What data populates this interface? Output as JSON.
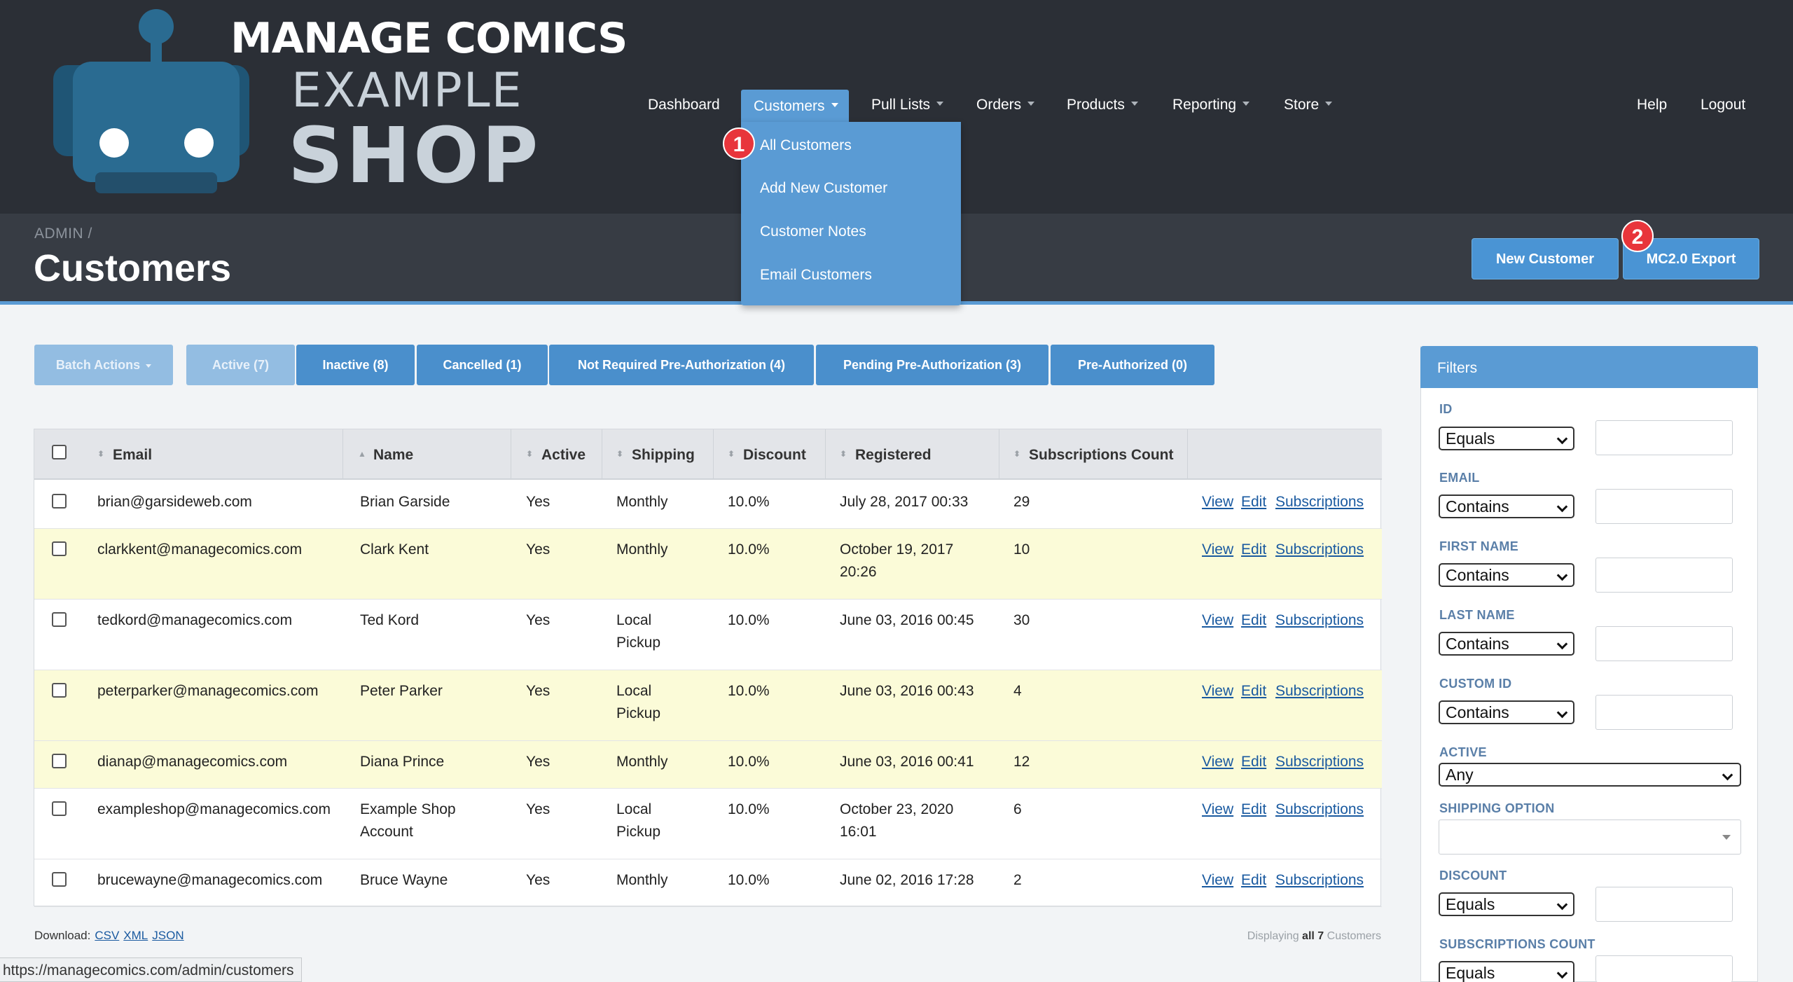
{
  "brand": {
    "line1": "MANAGE COMICS",
    "line2": "EXAMPLE",
    "line3": "SHOP"
  },
  "nav": {
    "dashboard": "Dashboard",
    "customers": "Customers",
    "pull_lists": "Pull Lists",
    "orders": "Orders",
    "products": "Products",
    "reporting": "Reporting",
    "store": "Store",
    "help": "Help",
    "logout": "Logout"
  },
  "dropdown": {
    "items": [
      "All Customers",
      "Add New Customer",
      "Customer Notes",
      "Email Customers"
    ]
  },
  "callouts": [
    "1",
    "2"
  ],
  "breadcrumb": "ADMIN /",
  "page_title": "Customers",
  "buttons": {
    "new_customer": "New Customer",
    "export": "MC2.0 Export"
  },
  "tabs": [
    "Batch Actions",
    "Active (7)",
    "Inactive (8)",
    "Cancelled (1)",
    "Not Required Pre-Authorization (4)",
    "Pending Pre-Authorization (3)",
    "Pre-Authorized (0)"
  ],
  "table": {
    "sort_up": "▲",
    "sort_both": "⬍",
    "columns": [
      "Email",
      "Name",
      "Active",
      "Shipping",
      "Discount",
      "Registered",
      "Subscriptions Count"
    ],
    "rows": [
      {
        "email": "brian@garsideweb.com",
        "name1": "Brian Garside",
        "name2": "",
        "active": "Yes",
        "ship1": "Monthly",
        "ship2": "",
        "discount": "10.0%",
        "reg1": "July 28, 2017 00:33",
        "reg2": "",
        "subs": "29"
      },
      {
        "email": "clarkkent@managecomics.com",
        "name1": "Clark Kent",
        "name2": "",
        "active": "Yes",
        "ship1": "Monthly",
        "ship2": "",
        "discount": "10.0%",
        "reg1": "October 19, 2017",
        "reg2": "20:26",
        "subs": "10"
      },
      {
        "email": "tedkord@managecomics.com",
        "name1": "Ted Kord",
        "name2": "",
        "active": "Yes",
        "ship1": "Local",
        "ship2": "Pickup",
        "discount": "10.0%",
        "reg1": "June 03, 2016 00:45",
        "reg2": "",
        "subs": "30"
      },
      {
        "email": "peterparker@managecomics.com",
        "name1": "Peter Parker",
        "name2": "",
        "active": "Yes",
        "ship1": "Local",
        "ship2": "Pickup",
        "discount": "10.0%",
        "reg1": "June 03, 2016 00:43",
        "reg2": "",
        "subs": "4"
      },
      {
        "email": "dianap@managecomics.com",
        "name1": "Diana Prince",
        "name2": "",
        "active": "Yes",
        "ship1": "Monthly",
        "ship2": "",
        "discount": "10.0%",
        "reg1": "June 03, 2016 00:41",
        "reg2": "",
        "subs": "12"
      },
      {
        "email": "exampleshop@managecomics.com",
        "name1": "Example Shop",
        "name2": "Account",
        "active": "Yes",
        "ship1": "Local",
        "ship2": "Pickup",
        "discount": "10.0%",
        "reg1": "October 23, 2020",
        "reg2": "16:01",
        "subs": "6"
      },
      {
        "email": "brucewayne@managecomics.com",
        "name1": "Bruce Wayne",
        "name2": "",
        "active": "Yes",
        "ship1": "Monthly",
        "ship2": "",
        "discount": "10.0%",
        "reg1": "June 02, 2016 17:28",
        "reg2": "",
        "subs": "2"
      }
    ],
    "actions": {
      "view": "View",
      "edit": "Edit",
      "subscriptions": "Subscriptions"
    }
  },
  "footer": {
    "download_label": "Download:",
    "formats": [
      "CSV",
      "XML",
      "JSON"
    ],
    "displaying_prefix": "Displaying",
    "displaying_count": "all 7",
    "displaying_suffix": "Customers"
  },
  "status_url": "https://managecomics.com/admin/customers",
  "filters": {
    "title": "Filters",
    "id": {
      "label": "ID",
      "op": "Equals"
    },
    "email": {
      "label": "EMAIL",
      "op": "Contains"
    },
    "first_name": {
      "label": "FIRST NAME",
      "op": "Contains"
    },
    "last_name": {
      "label": "LAST NAME",
      "op": "Contains"
    },
    "custom_id": {
      "label": "CUSTOM ID",
      "op": "Contains"
    },
    "active": {
      "label": "ACTIVE",
      "value": "Any"
    },
    "shipping": {
      "label": "SHIPPING OPTION",
      "value": ""
    },
    "discount": {
      "label": "DISCOUNT",
      "op": "Equals"
    },
    "subs_count": {
      "label": "SUBSCRIPTIONS COUNT",
      "op": "Equals"
    }
  },
  "colors": {
    "header_bg": "#2b2f36",
    "accent": "#5a9bd4",
    "row_highlight": "#fbfbd8",
    "badge": "#e8353b",
    "robot": "#2a6b91"
  }
}
